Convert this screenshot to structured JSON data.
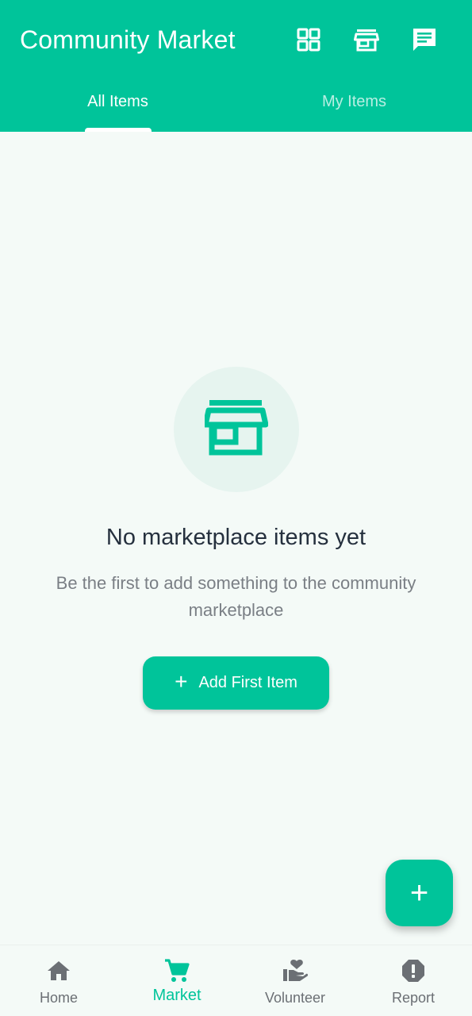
{
  "header": {
    "title": "Community Market",
    "icons": [
      "grid-view-icon",
      "storefront-icon",
      "chat-icon"
    ]
  },
  "tabs": [
    {
      "label": "All Items",
      "active": true
    },
    {
      "label": "My Items",
      "active": false
    }
  ],
  "empty_state": {
    "icon": "storefront-icon",
    "title": "No marketplace items yet",
    "subtitle": "Be the first to add something to the community marketplace",
    "button_label": "Add First Item",
    "button_icon": "plus-icon"
  },
  "fab": {
    "icon": "plus-icon"
  },
  "bottom_nav": [
    {
      "label": "Home",
      "icon": "home-icon",
      "active": false
    },
    {
      "label": "Market",
      "icon": "shopping-cart-icon",
      "active": true
    },
    {
      "label": "Volunteer",
      "icon": "volunteer-icon",
      "active": false
    },
    {
      "label": "Report",
      "icon": "report-icon",
      "active": false
    }
  ],
  "colors": {
    "primary": "#00c49a",
    "background": "#f4faf7",
    "title_text": "#25303e",
    "muted_text": "#7a7f85",
    "nav_inactive": "#6b6f74"
  }
}
